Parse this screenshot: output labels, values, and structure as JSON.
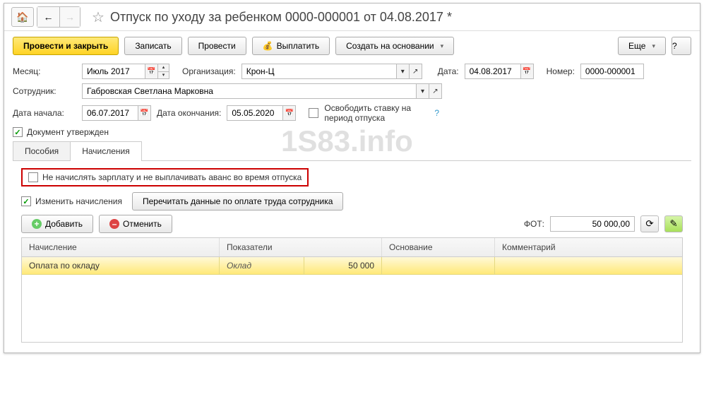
{
  "title": "Отпуск по уходу за ребенком 0000-000001 от 04.08.2017 *",
  "toolbar": {
    "save_close": "Провести и закрыть",
    "write": "Записать",
    "post": "Провести",
    "pay": "Выплатить",
    "create_based": "Создать на основании",
    "more": "Еще",
    "help": "?"
  },
  "form": {
    "month_label": "Месяц:",
    "month": "Июль 2017",
    "org_label": "Организация:",
    "org": "Крон-Ц",
    "date_label": "Дата:",
    "date": "04.08.2017",
    "number_label": "Номер:",
    "number": "0000-000001",
    "employee_label": "Сотрудник:",
    "employee": "Габровская Светлана Марковна",
    "start_date_label": "Дата начала:",
    "start_date": "06.07.2017",
    "end_date_label": "Дата окончания:",
    "end_date": "05.05.2020",
    "free_rate": "Освободить ставку на период отпуска",
    "approved": "Документ утвержден"
  },
  "tabs": {
    "benefits": "Пособия",
    "accruals": "Начисления"
  },
  "accruals": {
    "no_salary": "Не начислять зарплату и не выплачивать аванс во время отпуска",
    "change_accruals": "Изменить начисления",
    "reread": "Перечитать данные по оплате труда сотрудника",
    "add": "Добавить",
    "cancel": "Отменить",
    "fot_label": "ФОТ:",
    "fot_value": "50 000,00"
  },
  "table": {
    "headers": {
      "accrual": "Начисление",
      "indicators": "Показатели",
      "basis": "Основание",
      "comment": "Комментарий"
    },
    "rows": [
      {
        "accrual": "Оплата по окладу",
        "indicator_name": "Оклад",
        "indicator_value": "50 000",
        "basis": "",
        "comment": ""
      }
    ]
  },
  "watermark": "1S83.info"
}
